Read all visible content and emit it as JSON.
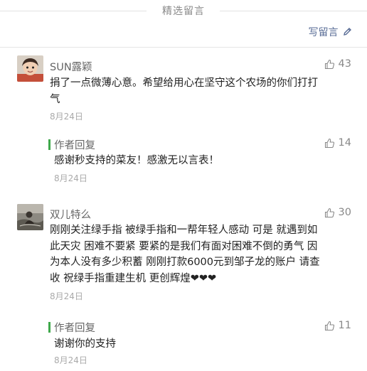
{
  "section_title": "精选留言",
  "write_comment_label": "写留言",
  "comments": [
    {
      "name": "SUN露颖",
      "likes": "43",
      "text": [
        "捐了一点微薄心意。希望给用心在坚守这个农场的你们打打",
        "气"
      ],
      "date": "8月24日",
      "reply": {
        "label": "作者回复",
        "likes": "14",
        "text": "感谢秒支持的菜友！感激无以言表！",
        "date": "8月24日"
      }
    },
    {
      "name": "双儿特么",
      "likes": "30",
      "text": [
        "刚刚关注绿手指 被绿手指和一帮年轻人感动 可是 就遇到如",
        "此天灾 困难不要紧 要紧的是我们有面对困难不倒的勇气 因",
        "为本人没有多少积蓄 刚刚打款6000元到邹子龙的账户 请查",
        "收 祝绿手指重建生机 更创辉煌❤❤❤"
      ],
      "date": "8月24日",
      "reply": {
        "label": "作者回复",
        "likes": "11",
        "text": "谢谢你的支持",
        "date": "8月24日"
      }
    }
  ]
}
